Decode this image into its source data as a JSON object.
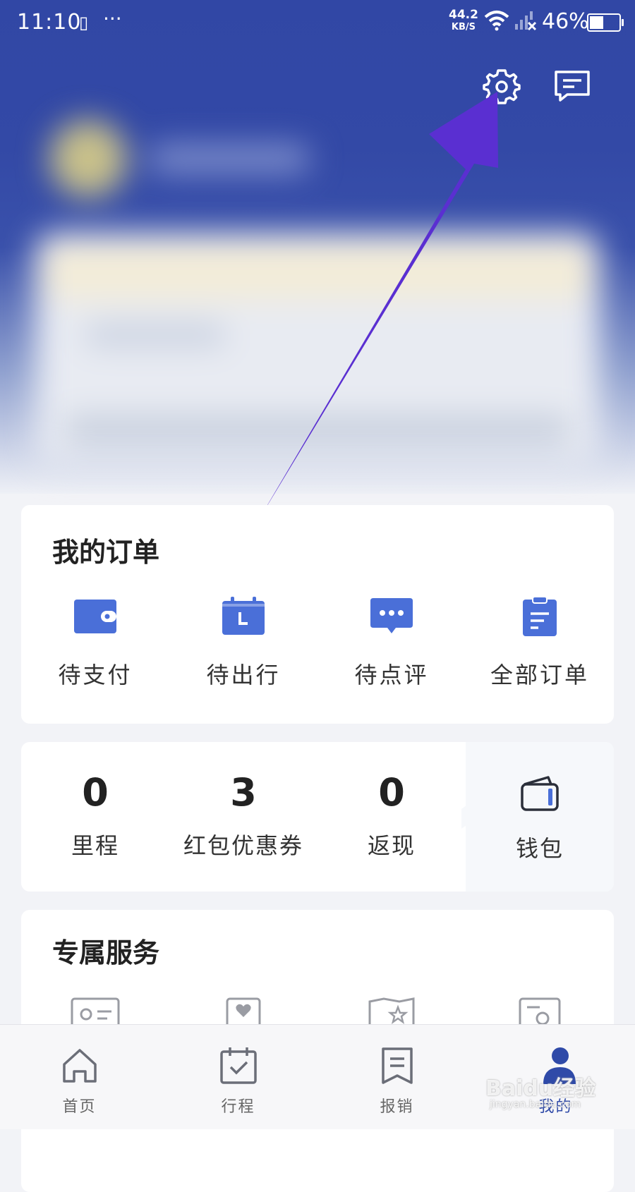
{
  "status_bar": {
    "time": "11:10",
    "network_speed": "44.2",
    "network_unit": "KB/S",
    "battery": "46%"
  },
  "orders": {
    "title": "我的订单",
    "items": [
      {
        "label": "待支付",
        "icon": "wallet-icon"
      },
      {
        "label": "待出行",
        "icon": "calendar-icon"
      },
      {
        "label": "待点评",
        "icon": "chat-icon"
      },
      {
        "label": "全部订单",
        "icon": "clipboard-icon"
      }
    ]
  },
  "stats": {
    "items": [
      {
        "value": "0",
        "label": "里程"
      },
      {
        "value": "3",
        "label": "红包优惠券"
      },
      {
        "value": "0",
        "label": "返现"
      }
    ],
    "wallet_label": "钱包"
  },
  "services": {
    "title": "专属服务"
  },
  "nav": {
    "items": [
      {
        "label": "首页",
        "icon": "home-icon"
      },
      {
        "label": "行程",
        "icon": "itinerary-icon"
      },
      {
        "label": "报销",
        "icon": "receipt-icon"
      },
      {
        "label": "我的",
        "icon": "profile-icon"
      }
    ]
  },
  "watermark": {
    "text": "Baidu经验",
    "sub": "jingyan.baidu.com"
  },
  "colors": {
    "header": "#3147a5",
    "accent": "#4a6fd8",
    "arrow": "#5a2fd1"
  }
}
